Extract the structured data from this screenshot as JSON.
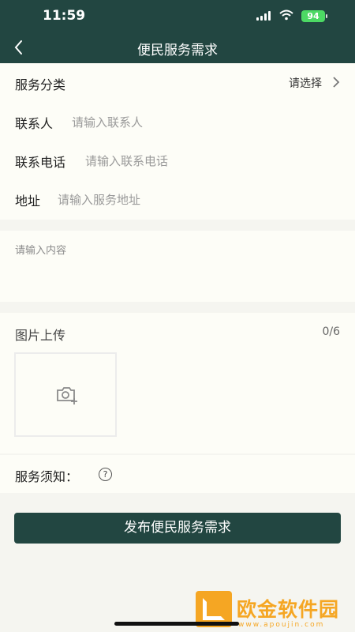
{
  "status_bar": {
    "time": "11:59",
    "battery": "94"
  },
  "navbar": {
    "title": "便民服务需求"
  },
  "form": {
    "category": {
      "label": "服务分类",
      "value": "请选择"
    },
    "contact": {
      "label": "联系人",
      "placeholder": "请输入联系人"
    },
    "phone": {
      "label": "联系电话",
      "placeholder": "请输入联系电话"
    },
    "address": {
      "label": "地址",
      "placeholder": "请输入服务地址"
    },
    "content": {
      "placeholder": "请输入内容"
    },
    "upload": {
      "label": "图片上传",
      "count": "0/6"
    },
    "notice": {
      "label": "服务须知：",
      "help_glyph": "?"
    }
  },
  "submit_label": "发布便民服务需求",
  "watermark": {
    "name": "欧金软件园",
    "url": "www.apoujin.com"
  },
  "colors": {
    "primary": "#224641",
    "accent": "#f5a623",
    "card": "#fdfdf7",
    "background": "#f5f5f0"
  }
}
